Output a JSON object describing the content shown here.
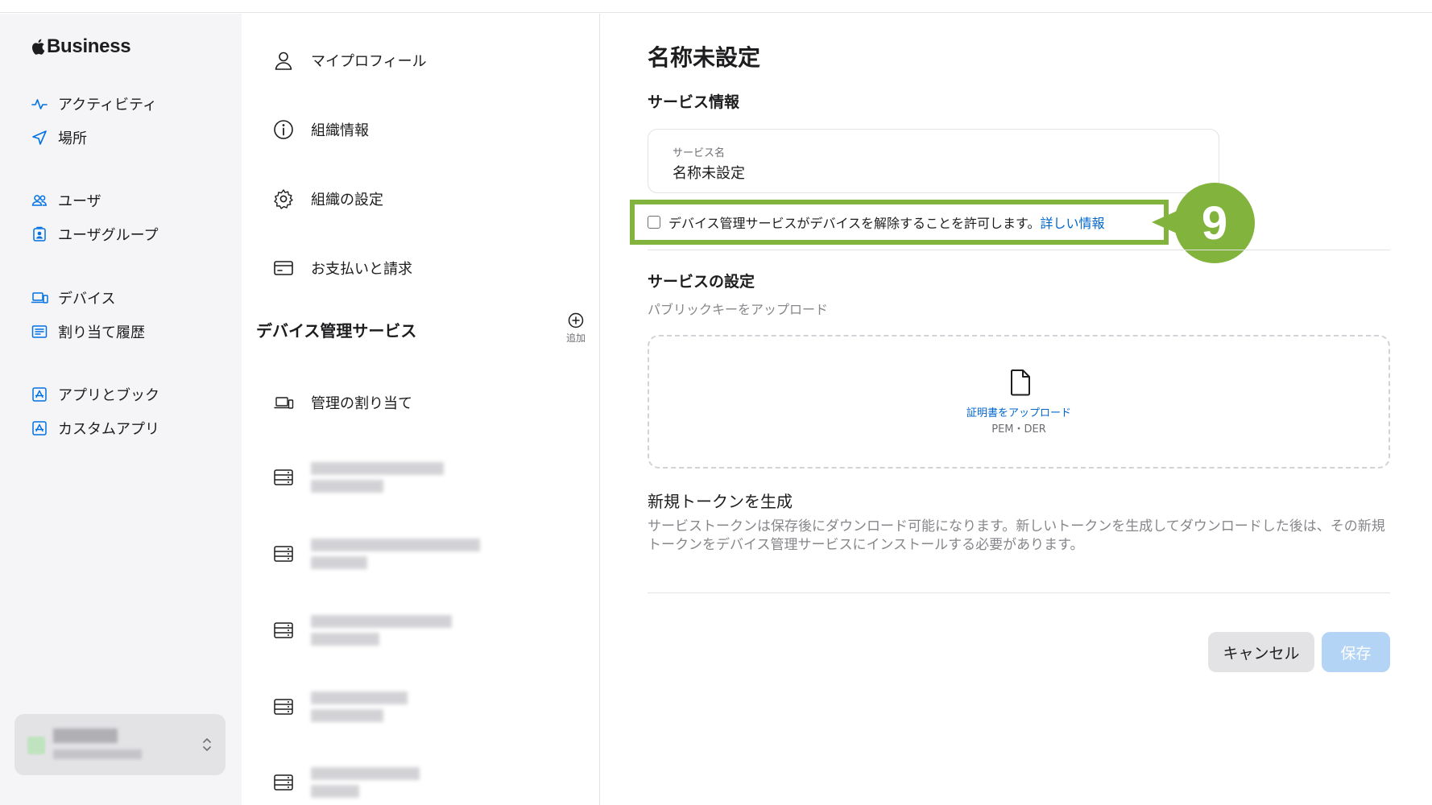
{
  "brand": {
    "name": "Business"
  },
  "sidebar": {
    "items": [
      {
        "label": "アクティビティ",
        "icon": "activity-icon"
      },
      {
        "label": "場所",
        "icon": "location-arrow-icon"
      },
      {
        "label": "ユーザ",
        "icon": "users-icon"
      },
      {
        "label": "ユーザグループ",
        "icon": "user-group-icon"
      },
      {
        "label": "デバイス",
        "icon": "devices-icon"
      },
      {
        "label": "割り当て履歴",
        "icon": "assignment-history-icon"
      },
      {
        "label": "アプリとブック",
        "icon": "app-store-icon"
      },
      {
        "label": "カスタムアプリ",
        "icon": "custom-app-icon"
      }
    ]
  },
  "settings_menu": {
    "items": [
      {
        "label": "マイプロフィール",
        "icon": "profile-icon"
      },
      {
        "label": "組織情報",
        "icon": "info-icon"
      },
      {
        "label": "組織の設定",
        "icon": "gear-icon"
      },
      {
        "label": "お支払いと請求",
        "icon": "credit-card-icon"
      }
    ],
    "section_title": "デバイス管理サービス",
    "add_label": "追加",
    "assign_label": "管理の割り当て"
  },
  "main": {
    "title": "名称未設定",
    "service_info_heading": "サービス情報",
    "service_name_label": "サービス名",
    "service_name_value": "名称未設定",
    "release_checkbox_label": "デバイス管理サービスがデバイスを解除することを許可します。",
    "learn_more": "詳しい情報",
    "callout_number": "9",
    "service_settings_heading": "サービスの設定",
    "upload_hint": "パブリックキーをアップロード",
    "upload_link": "証明書をアップロード",
    "upload_formats": "PEM・DER",
    "token_heading": "新規トークンを生成",
    "token_description": "サービストークンは保存後にダウンロード可能になります。新しいトークンを生成してダウンロードした後は、その新規トークンをデバイス管理サービスにインストールする必要があります。",
    "cancel_label": "キャンセル",
    "save_label": "保存"
  },
  "colors": {
    "accent": "#0066cc",
    "highlight": "#82b33c",
    "save_disabled": "#b3d4f5"
  }
}
